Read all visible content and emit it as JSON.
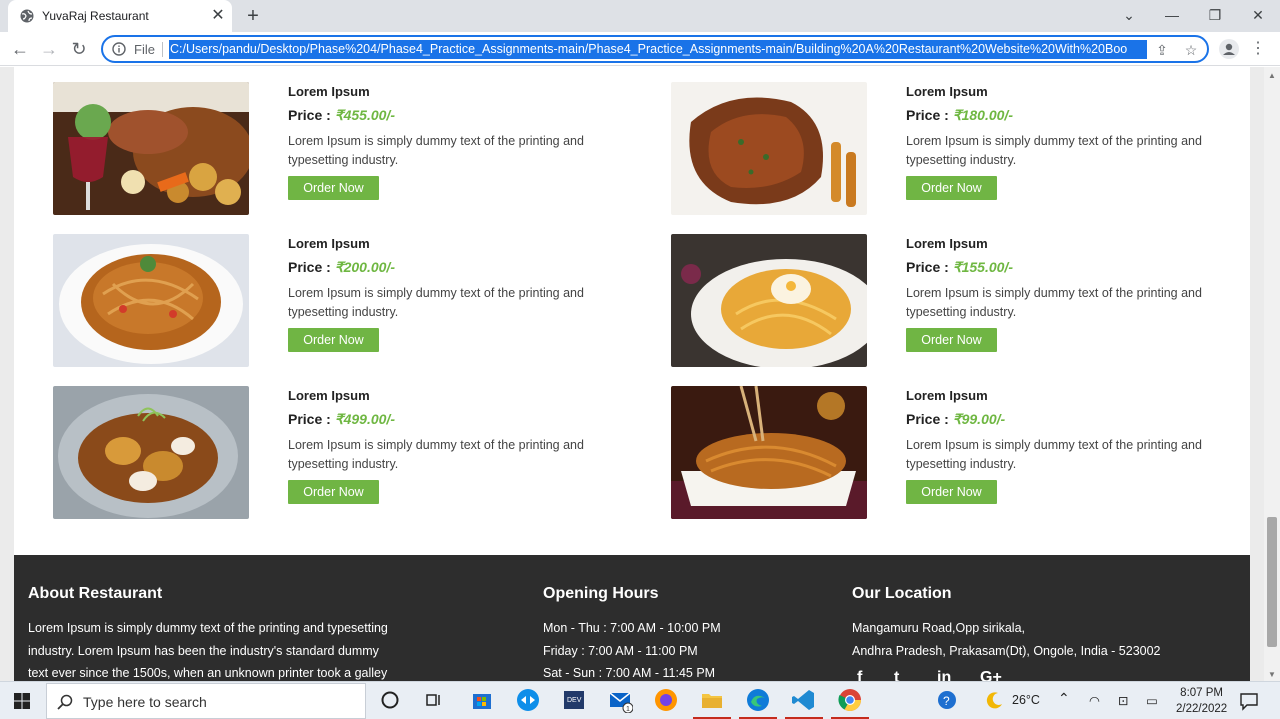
{
  "browser": {
    "tab_title": "YuvaRaj Restaurant",
    "tab_close": "✕",
    "new_tab": "+",
    "file_label": "File",
    "url": "C:/Users/pandu/Desktop/Phase%204/Phase4_Practice_Assignments-main/Phase4_Practice_Assignments-main/Building%20A%20Restaurant%20Website%20With%20Boo",
    "window_controls": {
      "tabs_menu": "⌄",
      "minimize": "—",
      "restore": "❐",
      "close": "✕"
    }
  },
  "menu": {
    "items": [
      {
        "title": "Lorem Ipsum",
        "price_label": "Price :",
        "price": "₹455.00/-",
        "description": "Lorem Ipsum is simply dummy text of the printing and typesetting industry.",
        "button": "Order Now",
        "image": "roast-platter"
      },
      {
        "title": "Lorem Ipsum",
        "price_label": "Price :",
        "price": "₹180.00/-",
        "description": "Lorem Ipsum is simply dummy text of the printing and typesetting industry.",
        "button": "Order Now",
        "image": "grilled-chicken"
      },
      {
        "title": "Lorem Ipsum",
        "price_label": "Price :",
        "price": "₹200.00/-",
        "description": "Lorem Ipsum is simply dummy text of the printing and typesetting industry.",
        "button": "Order Now",
        "image": "noodles-plate"
      },
      {
        "title": "Lorem Ipsum",
        "price_label": "Price :",
        "price": "₹155.00/-",
        "description": "Lorem Ipsum is simply dummy text of the printing and typesetting industry.",
        "button": "Order Now",
        "image": "egg-noodles"
      },
      {
        "title": "Lorem Ipsum",
        "price_label": "Price :",
        "price": "₹499.00/-",
        "description": "Lorem Ipsum is simply dummy text of the printing and typesetting industry.",
        "button": "Order Now",
        "image": "seafood-dish"
      },
      {
        "title": "Lorem Ipsum",
        "price_label": "Price :",
        "price": "₹99.00/-",
        "description": "Lorem Ipsum is simply dummy text of the printing and typesetting industry.",
        "button": "Order Now",
        "image": "chopstick-noodles"
      }
    ]
  },
  "footer": {
    "about": {
      "heading": "About Restaurant",
      "lines": [
        "Lorem Ipsum is simply dummy text of the printing and typesetting",
        "industry. Lorem Ipsum has been the industry's standard dummy",
        "text ever since the 1500s, when an unknown printer took a galley"
      ]
    },
    "hours": {
      "heading": "Opening Hours",
      "lines": [
        "Mon - Thu : 7:00 AM - 10:00 PM",
        "Friday : 7:00 AM - 11:00 PM",
        "Sat - Sun : 7:00 AM - 11:45 PM"
      ]
    },
    "location": {
      "heading": "Our Location",
      "lines": [
        "Mangamuru Road,Opp sirikala,",
        "Andhra Pradesh, Prakasam(Dt), Ongole, India - 523002"
      ],
      "social": [
        "f",
        "t",
        "in",
        "G+"
      ]
    }
  },
  "taskbar": {
    "search_placeholder": "Type here to search",
    "weather": "26°C",
    "time": "8:07 PM",
    "date": "2/22/2022",
    "mail_badge": "1"
  },
  "colors": {
    "accent_green": "#70b544",
    "price_green": "#6fb742",
    "footer_bg": "#2d2d2d",
    "omnibox_focus": "#1a73e8"
  }
}
